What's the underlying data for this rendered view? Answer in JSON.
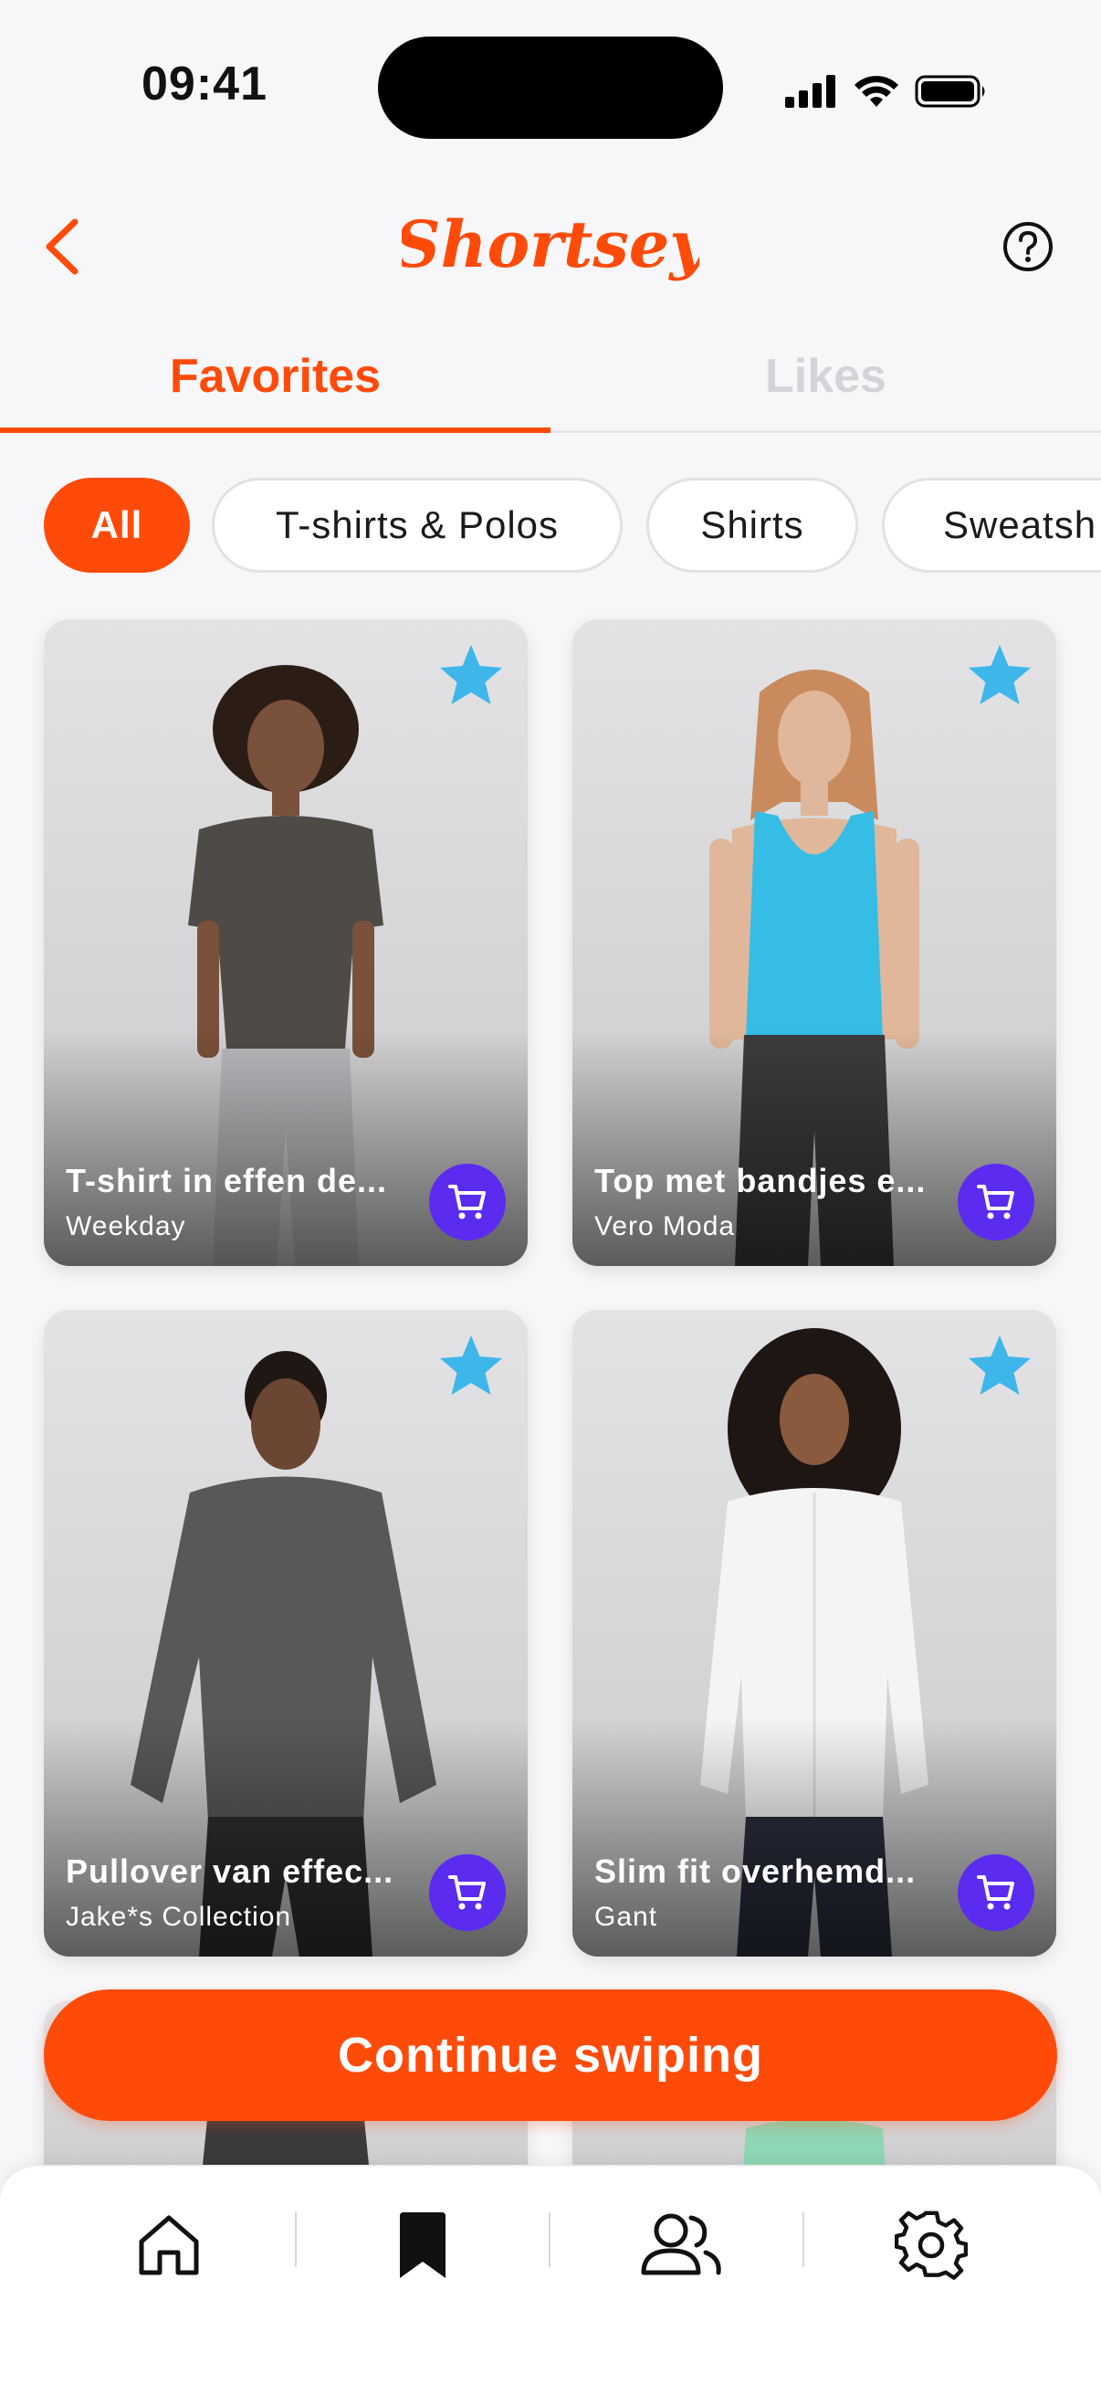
{
  "status_bar": {
    "time": "09:41"
  },
  "header": {
    "logo_text": "Shortsey",
    "back_icon": "chevron-left-icon",
    "help_icon": "question-circle-icon"
  },
  "tabs": [
    {
      "label": "Favorites",
      "active": true
    },
    {
      "label": "Likes",
      "active": false
    }
  ],
  "filters": [
    {
      "label": "All",
      "active": true
    },
    {
      "label": "T-shirts & Polos",
      "active": false
    },
    {
      "label": "Shirts",
      "active": false
    },
    {
      "label": "Sweatsh",
      "active": false
    }
  ],
  "products": [
    {
      "title": "T-shirt in effen de...",
      "brand": "Weekday",
      "favorited": true
    },
    {
      "title": "Top met bandjes e...",
      "brand": "Vero Moda",
      "favorited": true
    },
    {
      "title": "Pullover van effec...",
      "brand": "Jake*s Collection",
      "favorited": true
    },
    {
      "title": "Slim fit overhemd...",
      "brand": "Gant",
      "favorited": true
    }
  ],
  "continue_button": {
    "label": "Continue swiping"
  },
  "bottom_nav": [
    {
      "icon": "home-icon",
      "active": false
    },
    {
      "icon": "bookmark-icon",
      "active": true
    },
    {
      "icon": "people-icon",
      "active": false
    },
    {
      "icon": "gear-icon",
      "active": false
    }
  ],
  "colors": {
    "brand": "#ff4b0a",
    "cart": "#5b2bf0",
    "star": "#3fb6ea",
    "inactive_tab": "#d4d4d8"
  }
}
